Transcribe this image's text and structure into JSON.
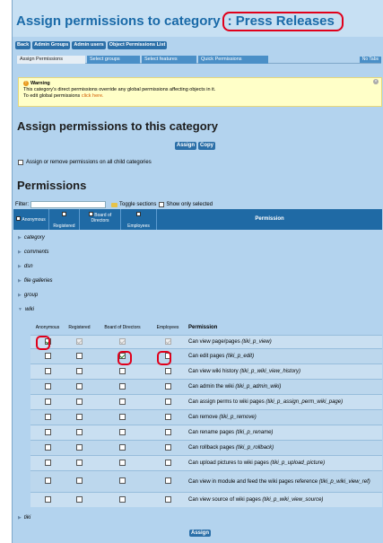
{
  "title": {
    "prefix": "Assign permissions to category",
    "colon": ":",
    "category": "Press Releases"
  },
  "nav_buttons": [
    "Back",
    "Admin Groups",
    "Admin users",
    "Object Permissions List"
  ],
  "tabs": [
    "Assign Permissions",
    "Select groups",
    "Select features",
    "Quick Permissions"
  ],
  "no_tabs": "No Tabs",
  "warning": {
    "title": "Warning",
    "line1": "This category's direct permissions override any global permissions affecting objects in it.",
    "line2_prefix": "To edit global permissions",
    "line2_link": "click here."
  },
  "section_title": "Assign permissions to this category",
  "assign_label": "Assign",
  "copy_label": "Copy",
  "child_categories_label": "Assign or remove permissions on all child categories",
  "permissions_title": "Permissions",
  "filter": {
    "label": "Filter:",
    "value": "",
    "toggle": "Toggle sections",
    "show_only": "Show only selected"
  },
  "header_groups": [
    "Anonymous",
    "Registered",
    "Board of Directors",
    "Employees"
  ],
  "header_permission": "Permission",
  "categories": [
    "category",
    "comments",
    "dsn",
    "file galleries",
    "group",
    "wiki"
  ],
  "tiki_label": "tiki",
  "wiki_columns": [
    "Anonymous",
    "Registered",
    "Board of Directors",
    "Employees",
    "Permission"
  ],
  "wiki_rows": [
    {
      "label": "Can view page/pages",
      "code": "(tiki_p_view)",
      "checks": [
        true,
        true,
        true,
        true
      ]
    },
    {
      "label": "Can edit pages",
      "code": "(tiki_p_edit)",
      "checks": [
        false,
        false,
        true,
        false
      ]
    },
    {
      "label": "Can view wiki history",
      "code": "(tiki_p_wiki_view_history)",
      "checks": [
        false,
        false,
        false,
        false
      ]
    },
    {
      "label": "Can admin the wiki",
      "code": "(tiki_p_admin_wiki)",
      "checks": [
        false,
        false,
        false,
        false
      ]
    },
    {
      "label": "Can assign perms to wiki pages",
      "code": "(tiki_p_assign_perm_wiki_page)",
      "checks": [
        false,
        false,
        false,
        false
      ]
    },
    {
      "label": "Can remove",
      "code": "(tiki_p_remove)",
      "checks": [
        false,
        false,
        false,
        false
      ]
    },
    {
      "label": "Can rename pages",
      "code": "(tiki_p_rename)",
      "checks": [
        false,
        false,
        false,
        false
      ]
    },
    {
      "label": "Can rollback pages",
      "code": "(tiki_p_rollback)",
      "checks": [
        false,
        false,
        false,
        false
      ]
    },
    {
      "label": "Can upload pictures to wiki pages",
      "code": "(tiki_p_upload_picture)",
      "checks": [
        false,
        false,
        false,
        false
      ]
    },
    {
      "label": "Can view in module and feed the wiki pages reference",
      "code": "(tiki_p_wiki_view_ref)",
      "checks": [
        false,
        false,
        false,
        false
      ]
    },
    {
      "label": "Can view source of wiki pages",
      "code": "(tiki_p_wiki_view_source)",
      "checks": [
        false,
        false,
        false,
        false
      ]
    }
  ]
}
